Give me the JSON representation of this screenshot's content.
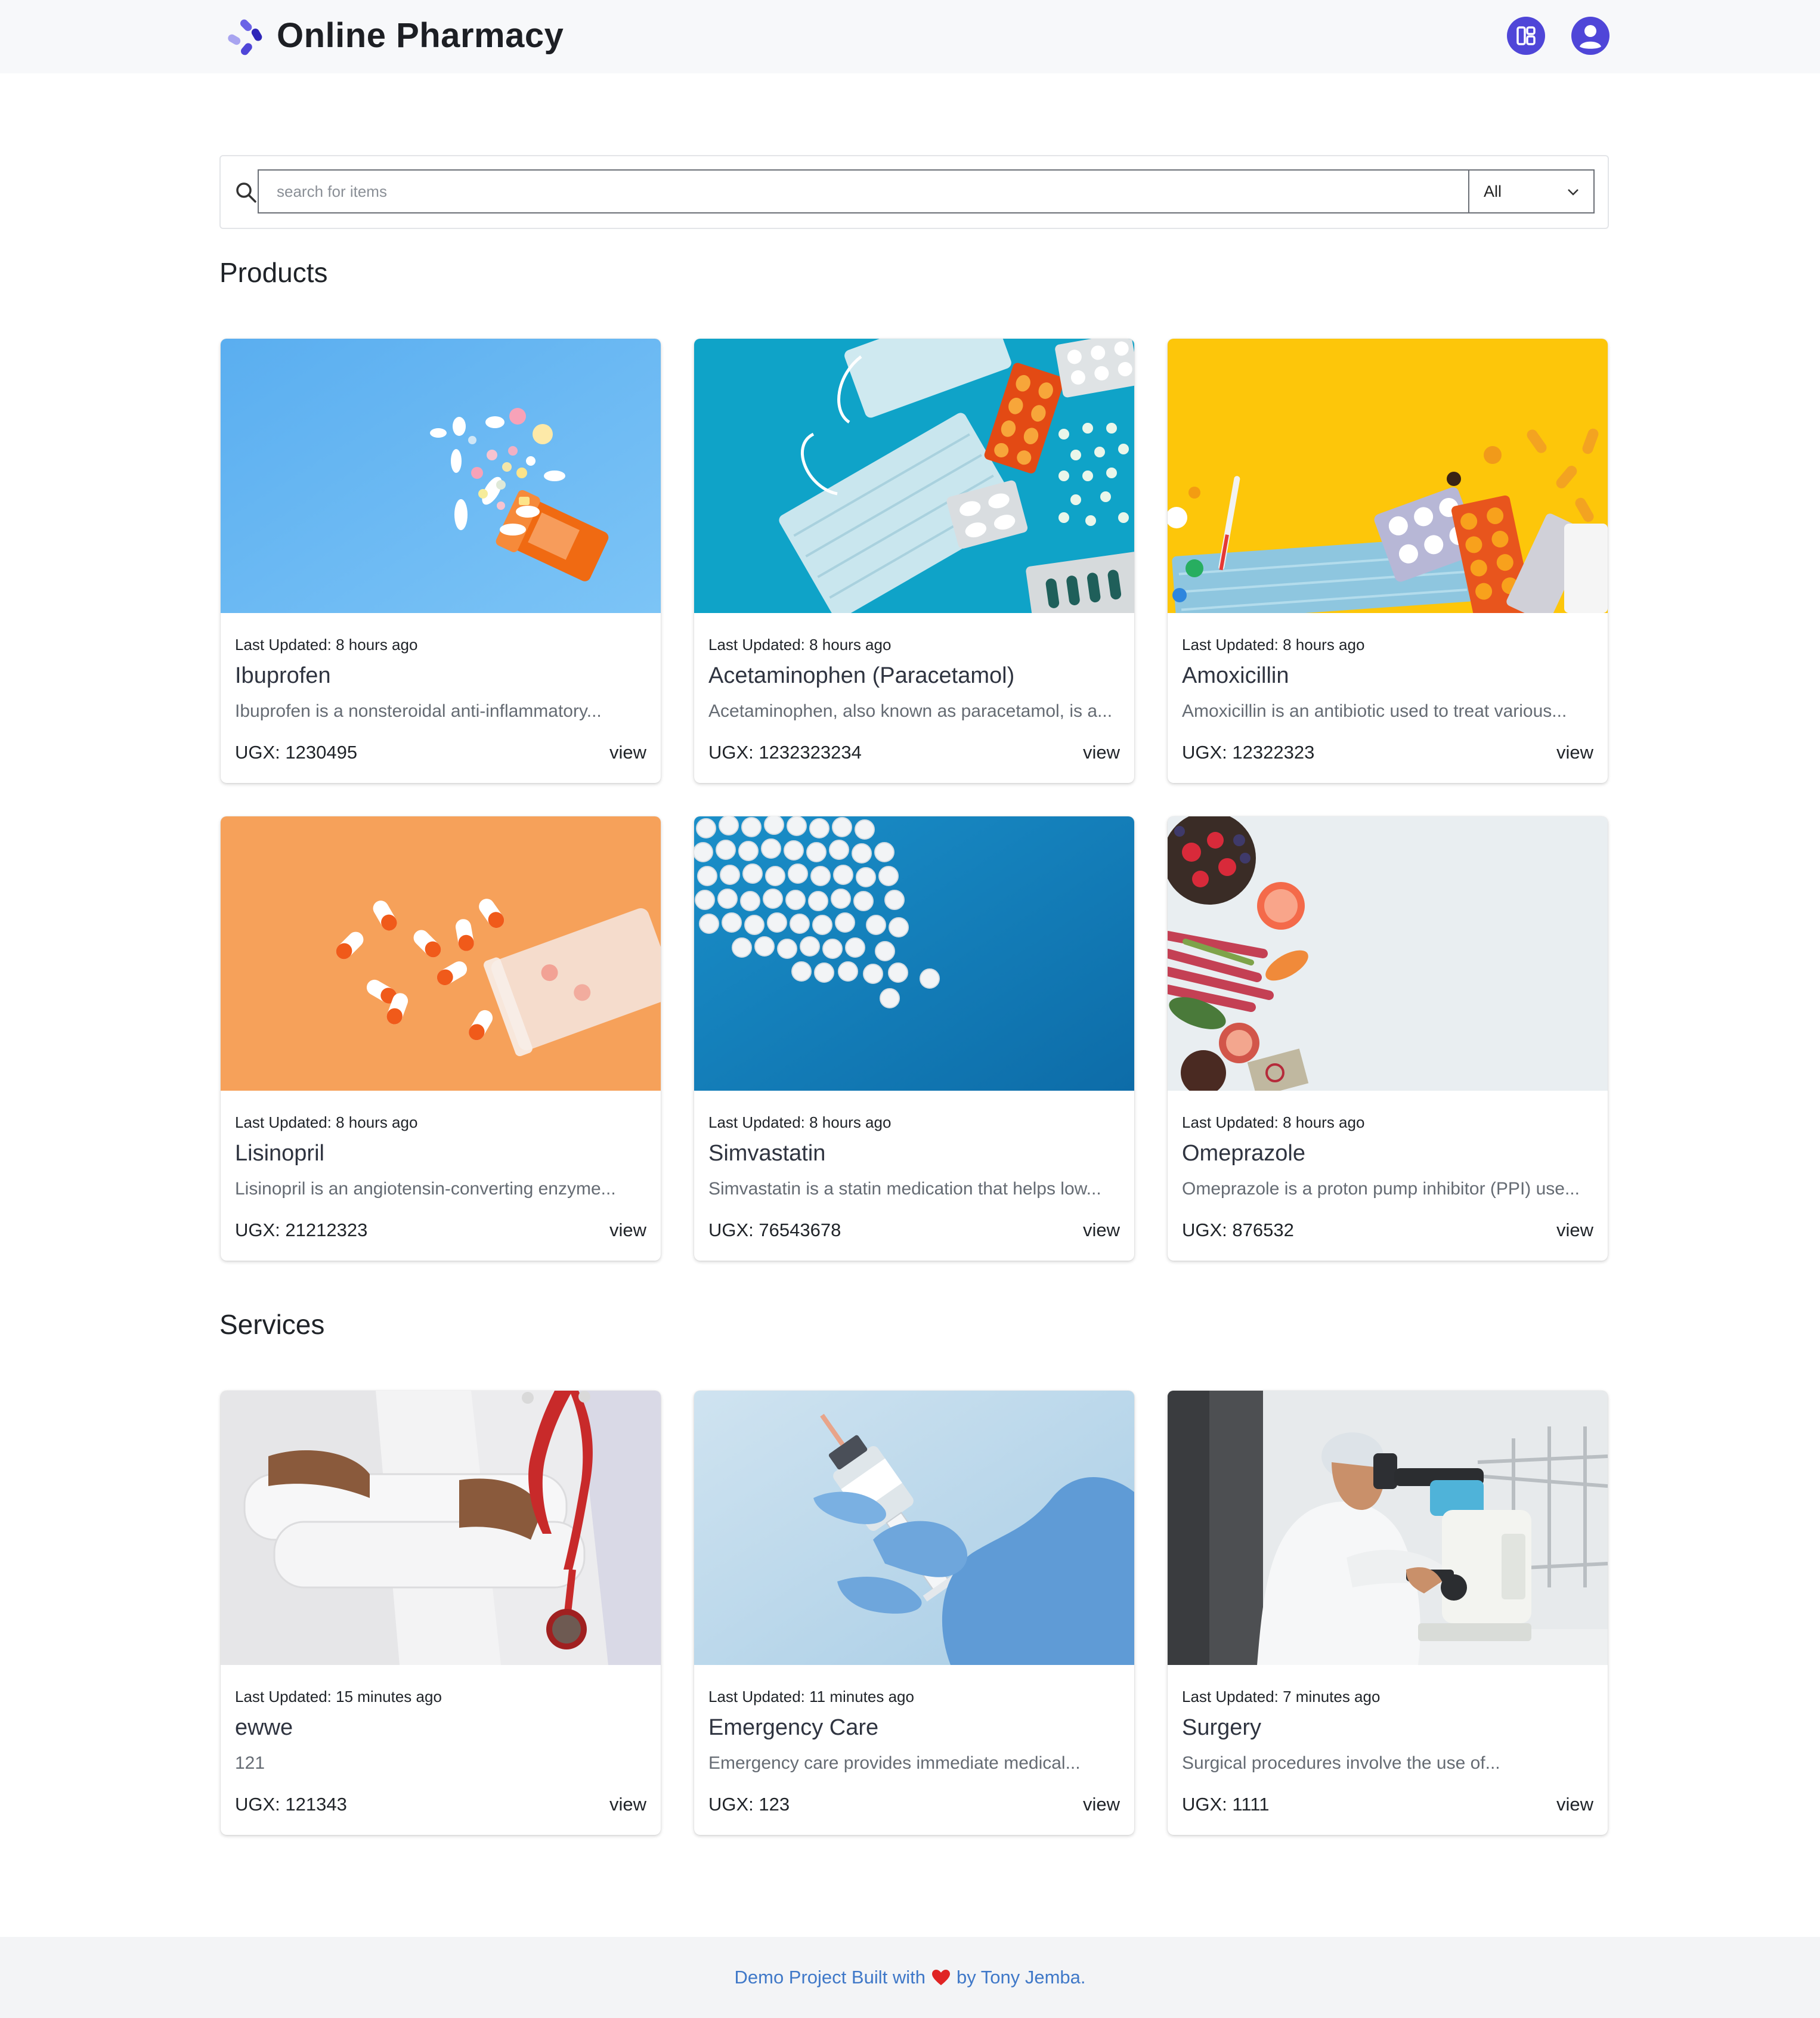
{
  "header": {
    "title": "Online Pharmacy",
    "logo_icon": "pills-logo-icon",
    "dashboard_icon": "dashboard-icon",
    "user_icon": "user-avatar-icon",
    "accent_color": "#4f46d8"
  },
  "search": {
    "placeholder": "search for items",
    "value": "",
    "filter_selected": "All"
  },
  "sections": {
    "products_title": "Products",
    "services_title": "Services"
  },
  "products": [
    {
      "updated": "Last Updated: 8 hours ago",
      "name": "Ibuprofen",
      "desc": "Ibuprofen is a nonsteroidal anti-inflammatory...",
      "price": "UGX: 1230495",
      "action": "view"
    },
    {
      "updated": "Last Updated: 8 hours ago",
      "name": "Acetaminophen (Paracetamol)",
      "desc": "Acetaminophen, also known as paracetamol, is a...",
      "price": "UGX: 1232323234",
      "action": "view"
    },
    {
      "updated": "Last Updated: 8 hours ago",
      "name": "Amoxicillin",
      "desc": "Amoxicillin is an antibiotic used to treat various...",
      "price": "UGX: 12322323",
      "action": "view"
    },
    {
      "updated": "Last Updated: 8 hours ago",
      "name": "Lisinopril",
      "desc": "Lisinopril is an angiotensin-converting enzyme...",
      "price": "UGX: 21212323",
      "action": "view"
    },
    {
      "updated": "Last Updated: 8 hours ago",
      "name": "Simvastatin",
      "desc": "Simvastatin is a statin medication that helps low...",
      "price": "UGX: 76543678",
      "action": "view"
    },
    {
      "updated": "Last Updated: 8 hours ago",
      "name": "Omeprazole",
      "desc": "Omeprazole is a proton pump inhibitor (PPI) use...",
      "price": "UGX: 876532",
      "action": "view"
    }
  ],
  "services": [
    {
      "updated": "Last Updated: 15 minutes ago",
      "name": "ewwe",
      "desc": "121",
      "price": "UGX: 121343",
      "action": "view"
    },
    {
      "updated": "Last Updated: 11 minutes ago",
      "name": "Emergency Care",
      "desc": "Emergency care provides immediate medical...",
      "price": "UGX: 123",
      "action": "view"
    },
    {
      "updated": "Last Updated: 7 minutes ago",
      "name": "Surgery",
      "desc": "Surgical procedures involve the use of...",
      "price": "UGX: 1111",
      "action": "view"
    }
  ],
  "footer": {
    "text_before": "Demo Project Built with",
    "heart_icon": "heart-icon",
    "text_after": "by Tony Jemba.",
    "link_color": "#3f78c8"
  }
}
